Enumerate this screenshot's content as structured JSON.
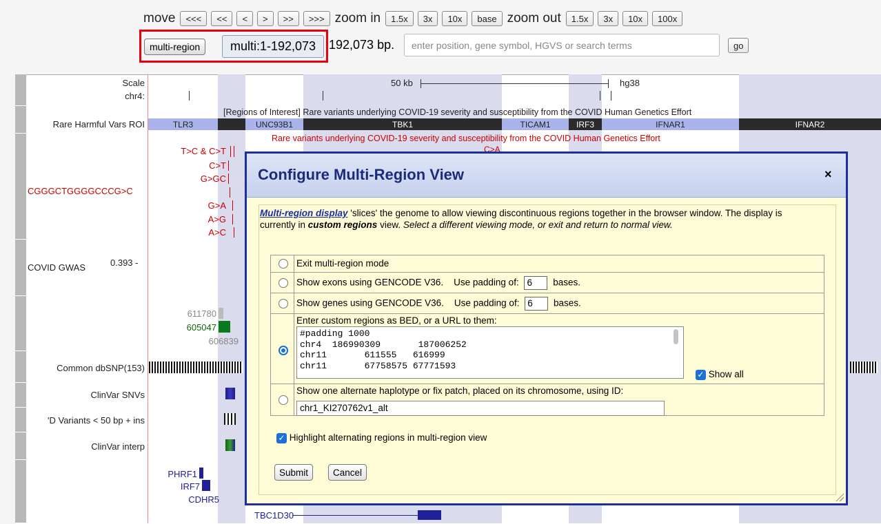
{
  "nav": {
    "move_label": "move",
    "move_buttons": [
      "<<<",
      "<<",
      "<",
      ">",
      ">>",
      ">>>"
    ],
    "zoom_in_label": "zoom in",
    "zoom_in_buttons": [
      "1.5x",
      "3x",
      "10x",
      "base"
    ],
    "zoom_out_label": "zoom out",
    "zoom_out_buttons": [
      "1.5x",
      "3x",
      "10x",
      "100x"
    ]
  },
  "position": {
    "multi_region_button": "multi-region",
    "position_text": "multi:1-192,073",
    "size_text": "192,073 bp.",
    "search_placeholder": "enter position, gene symbol, HGVS or search terms",
    "go_button": "go"
  },
  "colors": {
    "highlight": "#dadbed",
    "dialog_border": "#1c2fa0",
    "dialog_bg": "#fdfcd6",
    "accent": "#1a6fd8",
    "red_box": "#e8000b"
  },
  "tracks": {
    "scale_label": "Scale",
    "chr_label": "chr4:",
    "scale_text": "50 kb",
    "assembly": "hg38",
    "roi_title": "[Regions of Interest] Rare variants underlying COVID-19 severity and susceptibility from the COVID Human Genetics Effort",
    "roi_label": "Rare Harmful Vars ROI",
    "roi_genes": [
      "TLR3",
      "UNC93B1",
      "TBK1",
      "TICAM1",
      "IRF3",
      "IFNAR1",
      "IFNAR2"
    ],
    "rare_title": "Rare variants underlying COVID-19 severity and susceptibility from the COVID Human Genetics Effort",
    "rare_partial": "C>A",
    "variant_labels": [
      "T>C & C>T",
      "C>T",
      "G>GC",
      "G>A",
      "A>G",
      "A>C"
    ],
    "left_variant": "CGGGCTGGGGCCCG>C",
    "gwas_label": "COVID GWAS",
    "gwas_value": "0.393 -",
    "gwas_ids": [
      "611780",
      "605047",
      "606839"
    ],
    "dbsnp_label": "Common dbSNP(153)",
    "clinvar_snv_label": "ClinVar SNVs",
    "variants_label": "'D Variants < 50 bp + ins",
    "clinvar_interp_label": "ClinVar interp",
    "genes": [
      "PHRF1",
      "IRF7",
      "CDHR5",
      "TBC1D30"
    ]
  },
  "dialog": {
    "title": "Configure Multi-Region View",
    "close": "×",
    "desc_link": "Multi-region display",
    "desc_1": " 'slices' the genome to allow viewing discontinuous regions together in the browser window.  The display is currently in ",
    "desc_mode": "custom regions",
    "desc_2": " view.  ",
    "desc_3": "Select a different viewing mode, or exit and return to normal view.",
    "opt_exit": "Exit multi-region mode",
    "opt_exons": "Show exons using GENCODE V36.",
    "opt_genes": "Show genes using GENCODE V36.",
    "padding_label": "Use padding of:",
    "padding_value": "6",
    "bases_label": "bases.",
    "opt_custom": "Enter custom regions as BED, or a URL to them:",
    "custom_regions": "#padding 1000\nchr4  186990309       187006252\nchr11       611555   616999\nchr11       67758575 67771593",
    "show_all": "Show all",
    "opt_alt": "Show one alternate haplotype or fix patch, placed on its chromosome, using ID:",
    "alt_id": "chr1_KI270762v1_alt",
    "highlight_label": "Highlight alternating regions in multi-region view",
    "submit": "Submit",
    "cancel": "Cancel"
  }
}
